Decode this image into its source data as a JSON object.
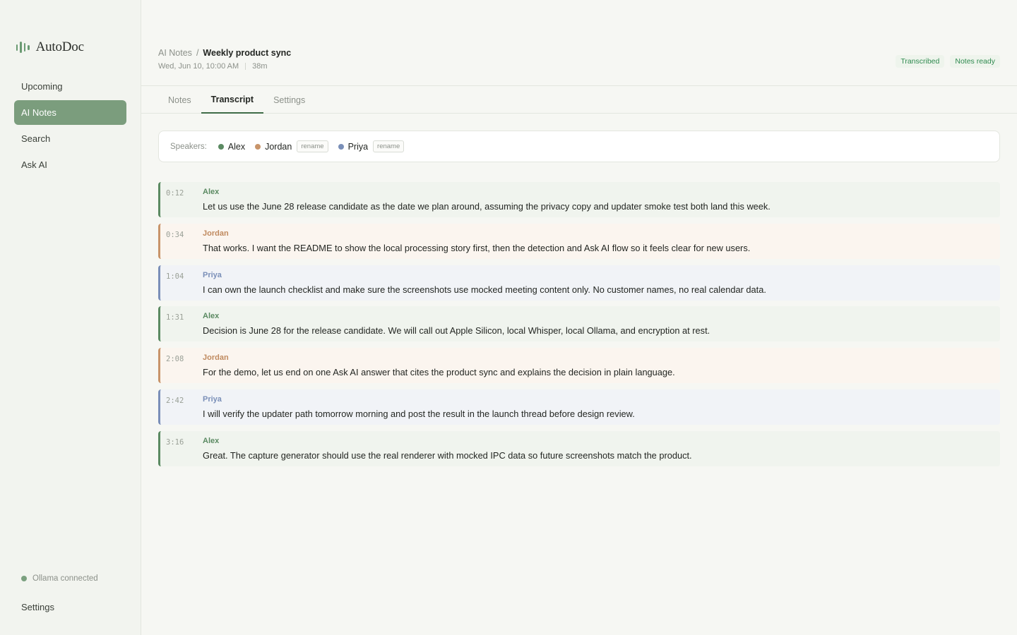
{
  "app": {
    "name": "AutoDoc"
  },
  "sidebar": {
    "items": [
      {
        "label": "Upcoming"
      },
      {
        "label": "AI Notes"
      },
      {
        "label": "Search"
      },
      {
        "label": "Ask AI"
      }
    ],
    "status": "Ollama connected",
    "settings_label": "Settings"
  },
  "header": {
    "breadcrumb_parent": "AI Notes",
    "breadcrumb_sep": "/",
    "title": "Weekly product sync",
    "date": "Wed, Jun 10, 10:00 AM",
    "duration": "38m",
    "badges": [
      "Transcribed",
      "Notes ready"
    ]
  },
  "tabs": [
    {
      "label": "Notes"
    },
    {
      "label": "Transcript"
    },
    {
      "label": "Settings"
    }
  ],
  "active_tab": "Transcript",
  "speakers": {
    "label": "Speakers:",
    "list": [
      {
        "name": "Alex",
        "color": "#5b8a62"
      },
      {
        "name": "Jordan",
        "color": "#c8946a",
        "rename": "rename"
      },
      {
        "name": "Priya",
        "color": "#7a8fb8",
        "rename": "rename"
      }
    ]
  },
  "transcript": [
    {
      "time": "0:12",
      "speaker": "Alex",
      "text": "Let us use the June 28 release candidate as the date we plan around, assuming the privacy copy and updater smoke test both land this week."
    },
    {
      "time": "0:34",
      "speaker": "Jordan",
      "text": "That works. I want the README to show the local processing story first, then the detection and Ask AI flow so it feels clear for new users."
    },
    {
      "time": "1:04",
      "speaker": "Priya",
      "text": "I can own the launch checklist and make sure the screenshots use mocked meeting content only. No customer names, no real calendar data."
    },
    {
      "time": "1:31",
      "speaker": "Alex",
      "text": "Decision is June 28 for the release candidate. We will call out Apple Silicon, local Whisper, local Ollama, and encryption at rest."
    },
    {
      "time": "2:08",
      "speaker": "Jordan",
      "text": "For the demo, let us end on one Ask AI answer that cites the product sync and explains the decision in plain language."
    },
    {
      "time": "2:42",
      "speaker": "Priya",
      "text": "I will verify the updater path tomorrow morning and post the result in the launch thread before design review."
    },
    {
      "time": "3:16",
      "speaker": "Alex",
      "text": "Great. The capture generator should use the real renderer with mocked IPC data so future screenshots match the product."
    }
  ]
}
